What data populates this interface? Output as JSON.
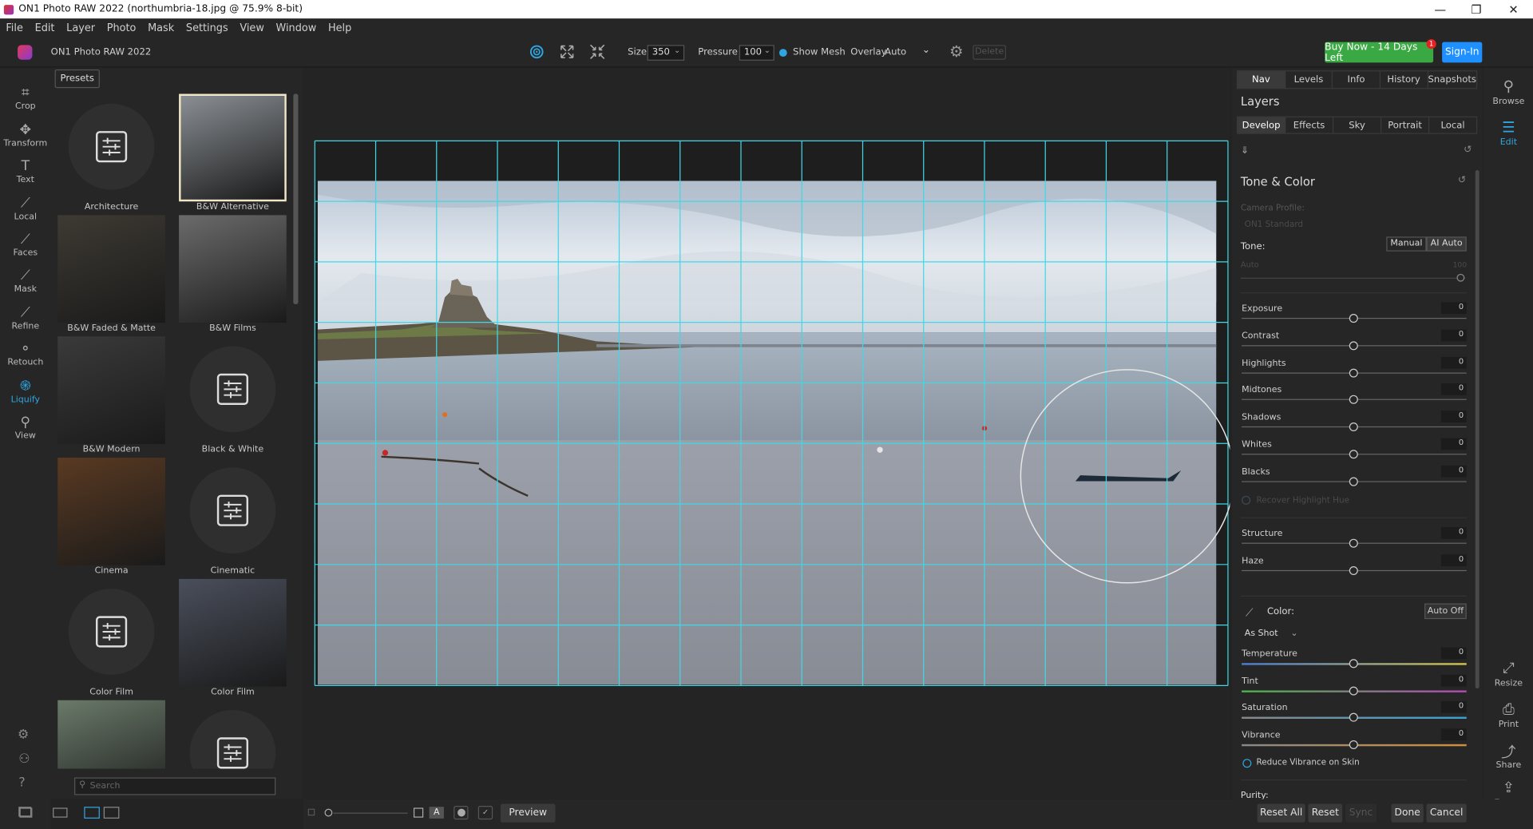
{
  "title": "ON1 Photo RAW 2022 (northumbria-18.jpg @ 75.9% 8-bit)",
  "window_controls": {
    "minimize": "—",
    "maximize": "❐",
    "close": "✕"
  },
  "menu": [
    "File",
    "Edit",
    "Layer",
    "Photo",
    "Mask",
    "Settings",
    "View",
    "Window",
    "Help"
  ],
  "toolbar": {
    "app_name": "ON1 Photo RAW 2022",
    "size_label": "Size",
    "size_value": "350",
    "pressure_label": "Pressure",
    "pressure_value": "100",
    "show_mesh_label": "Show Mesh",
    "overlay_label": "Overlay",
    "overlay_value": "Auto",
    "delete_label": "Delete",
    "buy_label": "Buy Now - 14 Days Left",
    "buy_badge": "1",
    "signin_label": "Sign-In"
  },
  "left_tools": [
    {
      "label": "Crop",
      "icon": "crop-icon",
      "glyph": "⌗"
    },
    {
      "label": "Transform",
      "icon": "transform-icon",
      "glyph": "✥"
    },
    {
      "label": "Text",
      "icon": "text-icon",
      "glyph": "T"
    },
    {
      "label": "Local",
      "icon": "local-brush-icon",
      "glyph": "⟋"
    },
    {
      "label": "Faces",
      "icon": "faces-icon",
      "glyph": "⟋"
    },
    {
      "label": "Mask",
      "icon": "mask-brush-icon",
      "glyph": "⟋"
    },
    {
      "label": "Refine",
      "icon": "refine-brush-icon",
      "glyph": "⟋"
    },
    {
      "label": "Retouch",
      "icon": "retouch-icon",
      "glyph": "⚬"
    },
    {
      "label": "Liquify",
      "icon": "liquify-icon",
      "glyph": "֍",
      "active": true
    },
    {
      "label": "View",
      "icon": "view-zoom-icon",
      "glyph": "⚲"
    }
  ],
  "presets": {
    "tab_label": "Presets",
    "search_placeholder": "Search",
    "items": [
      {
        "label": "Architecture",
        "kind": "icon"
      },
      {
        "label": "B&W Alternative",
        "kind": "photo",
        "color": "#8a8f94",
        "selected": true
      },
      {
        "label": "B&W Faded & Matte",
        "kind": "photo",
        "color": "#3e3a33"
      },
      {
        "label": "B&W Films",
        "kind": "photo",
        "color": "#6b6b6b"
      },
      {
        "label": "B&W Modern",
        "kind": "photo",
        "color": "#3a3a3a"
      },
      {
        "label": "Black & White",
        "kind": "icon"
      },
      {
        "label": "Cinema",
        "kind": "photo",
        "color": "#5a3a22"
      },
      {
        "label": "Cinematic",
        "kind": "icon"
      },
      {
        "label": "Color Film",
        "kind": "icon"
      },
      {
        "label": "Color Film",
        "kind": "photo",
        "color": "#4a4f5c"
      },
      {
        "label": "",
        "kind": "photo",
        "color": "#6a7a6a"
      },
      {
        "label": "",
        "kind": "icon"
      }
    ]
  },
  "right_panel": {
    "top_tabs": [
      "Nav",
      "Levels",
      "Info",
      "History",
      "Snapshots"
    ],
    "layers_label": "Layers",
    "module_tabs": [
      "Develop",
      "Effects",
      "Sky",
      "Portrait",
      "Local"
    ],
    "section_title": "Tone & Color",
    "camera_profile_label": "Camera Profile:",
    "camera_profile_value": "ON1 Standard",
    "tone_label": "Tone:",
    "manual_label": "Manual",
    "ai_auto_label": "AI Auto",
    "auto_label": "Auto",
    "auto_value": "100",
    "tone_sliders": [
      {
        "label": "Exposure",
        "value": "0"
      },
      {
        "label": "Contrast",
        "value": "0"
      },
      {
        "label": "Highlights",
        "value": "0"
      },
      {
        "label": "Midtones",
        "value": "0"
      },
      {
        "label": "Shadows",
        "value": "0"
      },
      {
        "label": "Whites",
        "value": "0"
      },
      {
        "label": "Blacks",
        "value": "0"
      }
    ],
    "recover_label": "Recover Highlight Hue",
    "extra_sliders": [
      {
        "label": "Structure",
        "value": "0"
      },
      {
        "label": "Haze",
        "value": "0"
      }
    ],
    "color_label": "Color:",
    "auto_off_label": "Auto Off",
    "as_shot_label": "As Shot",
    "color_sliders": [
      {
        "label": "Temperature",
        "value": "0",
        "track": "linear-gradient(90deg,#4a7bd0,#d0c24a)"
      },
      {
        "label": "Tint",
        "value": "0",
        "track": "linear-gradient(90deg,#4ab04a,#b04ab0)"
      },
      {
        "label": "Saturation",
        "value": "0",
        "track": "linear-gradient(90deg,#888,#3aa0d0)"
      },
      {
        "label": "Vibrance",
        "value": "0",
        "track": "linear-gradient(90deg,#888,#d0903a)"
      }
    ],
    "reduce_vibrance_label": "Reduce Vibrance on Skin",
    "purity_label": "Purity:"
  },
  "right_nav": [
    {
      "label": "Browse",
      "icon": "browse-icon",
      "glyph": "⚲"
    },
    {
      "label": "Edit",
      "icon": "edit-sliders-icon",
      "glyph": "☰",
      "active": true
    },
    {
      "label": "Resize",
      "icon": "resize-icon",
      "glyph": "⤢"
    },
    {
      "label": "Print",
      "icon": "print-icon",
      "glyph": "⎙"
    },
    {
      "label": "Share",
      "icon": "share-icon",
      "glyph": "⤴"
    },
    {
      "label": "Export",
      "icon": "export-icon",
      "glyph": "⇪"
    }
  ],
  "bottom": {
    "preview_label": "Preview",
    "reset_all_label": "Reset All",
    "reset_label": "Reset",
    "sync_label": "Sync",
    "done_label": "Done",
    "cancel_label": "Cancel"
  },
  "colors": {
    "accent": "#2fa6e0",
    "mesh": "#3fd8e6",
    "green": "#3aa843",
    "blue": "#1e90ff"
  }
}
